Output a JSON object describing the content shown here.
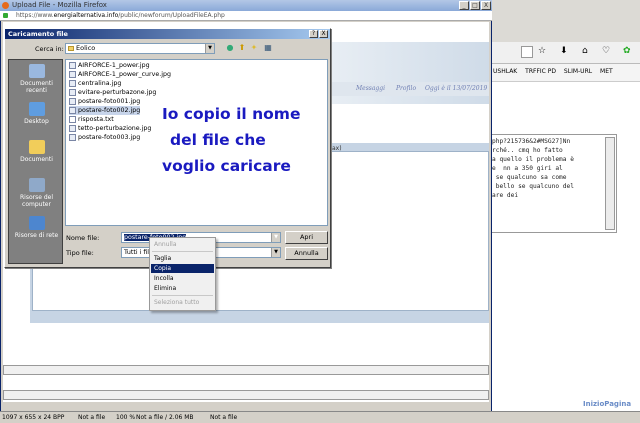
{
  "browser": {
    "title": "Upload File - Mozilla Firefox",
    "url_prefix": "https://www.",
    "url_domain": "energialternativa.info",
    "url_path": "/public/newforum/UploadFileEA.php",
    "min_btn": "_",
    "max_btn": "□",
    "close_btn": "X"
  },
  "page": {
    "header_links": [
      "Messaggi",
      "Profilo",
      "Oggi è il 13/07/2019"
    ],
    "ghost_text": "ax)"
  },
  "background_window": {
    "bookmarks": [
      "USHLAK",
      "TRFFIC PD",
      "SLIM-URL",
      "MET"
    ],
    "code_lines": [
      "php?215736&2#MSG27]Nn",
      "rché.. cmq ho fatto",
      "a quello il problema è",
      "e  nn a 350 giri al",
      " se qualcuno sa come",
      " bello se qualcuno del",
      "are dei"
    ],
    "footer_link": "InizioPagina"
  },
  "dialog": {
    "title": "Caricamento file",
    "help_btn": "?",
    "close_btn": "X",
    "look_in_label": "Cerca in:",
    "look_in_value": "Eolico",
    "places": [
      "Documenti recenti",
      "Desktop",
      "Documenti",
      "Risorse del computer",
      "Risorse di rete"
    ],
    "files": [
      {
        "name": "AIRFORCE-1_power.jpg",
        "type": "img"
      },
      {
        "name": "AIRFORCE-1_power_curve.jpg",
        "type": "img"
      },
      {
        "name": "centralina.jpg",
        "type": "img"
      },
      {
        "name": "evitare-perturbazone.jpg",
        "type": "img"
      },
      {
        "name": "postare-foto001.jpg",
        "type": "img"
      },
      {
        "name": "postare-foto002.jpg",
        "type": "img",
        "selected": true
      },
      {
        "name": "risposta.txt",
        "type": "txt"
      },
      {
        "name": "tetto-perturbazione.jpg",
        "type": "img"
      },
      {
        "name": "postare-foto003.jpg",
        "type": "img"
      }
    ],
    "filename_label": "Nome file:",
    "filename_value": "postare-foto002.jpg",
    "filetype_label": "Tipo file:",
    "filetype_value": "Tutti i file",
    "open_btn": "Apri",
    "cancel_btn": "Annulla"
  },
  "context_menu": {
    "items": [
      {
        "label": "Annulla",
        "disabled": true
      },
      {
        "label": "Taglia",
        "disabled": false
      },
      {
        "label": "Copia",
        "disabled": false,
        "highlighted": true
      },
      {
        "label": "Incolla",
        "disabled": false
      },
      {
        "label": "Elimina",
        "disabled": false
      },
      {
        "label": "Seleziona tutto",
        "disabled": true
      }
    ]
  },
  "annotation": {
    "lines": [
      "Io copio il nome",
      "del file che",
      "voglio caricare"
    ]
  },
  "statusbar": {
    "dimensions": "1097 x 655 x 24 BPP",
    "sel1": "Not a file",
    "zoom": "100 %",
    "size": "Not a file / 2.06 MB",
    "sel2": "Not a file"
  },
  "colors": {
    "dialog_title": "#0a246a",
    "annotation": "#1a1ac0",
    "menu_highlight": "#0a246a"
  }
}
